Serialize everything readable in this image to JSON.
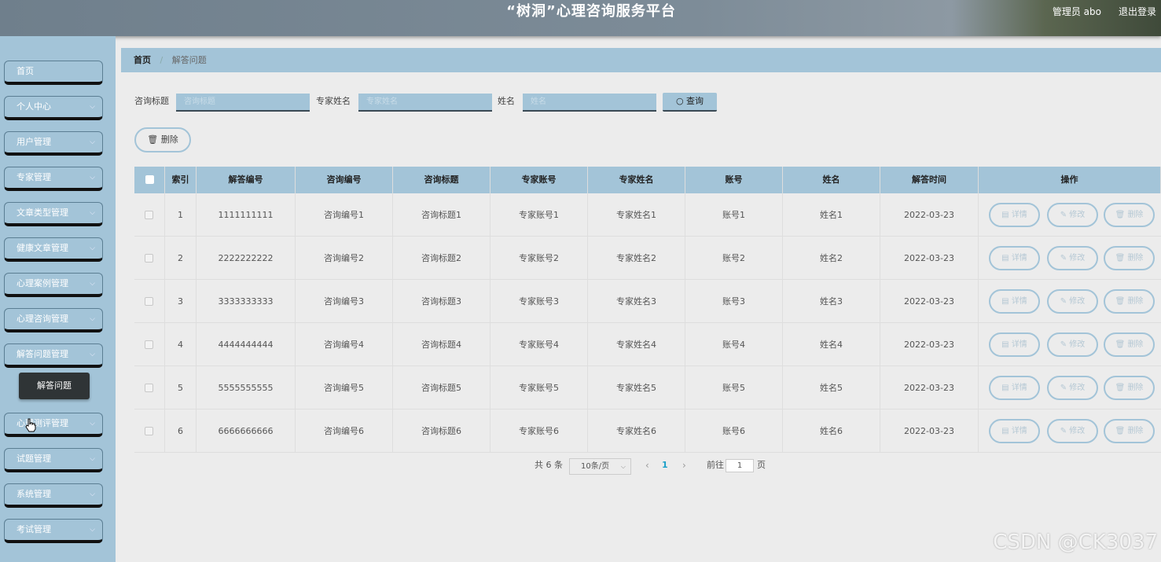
{
  "header": {
    "title": "“树洞”心理咨询服务平台",
    "user": "管理员 abo",
    "logout": "退出登录"
  },
  "sidebar": {
    "items": [
      {
        "label": "首页",
        "has_chevron": false
      },
      {
        "label": "个人中心",
        "has_chevron": true
      },
      {
        "label": "用户管理",
        "has_chevron": true
      },
      {
        "label": "专家管理",
        "has_chevron": true
      },
      {
        "label": "文章类型管理",
        "has_chevron": true
      },
      {
        "label": "健康文章管理",
        "has_chevron": true
      },
      {
        "label": "心理案例管理",
        "has_chevron": true
      },
      {
        "label": "心理咨询管理",
        "has_chevron": true
      },
      {
        "label": "解答问题管理",
        "has_chevron": true
      },
      {
        "label": "心理测评管理",
        "has_chevron": true
      },
      {
        "label": "试题管理",
        "has_chevron": true
      },
      {
        "label": "系统管理",
        "has_chevron": true
      },
      {
        "label": "考试管理",
        "has_chevron": true
      }
    ],
    "submenu": {
      "label": "解答问题"
    }
  },
  "breadcrumb": {
    "home": "首页",
    "current": "解答问题"
  },
  "search": {
    "fields": [
      {
        "label": "咨询标题",
        "placeholder": "咨询标题"
      },
      {
        "label": "专家姓名",
        "placeholder": "专家姓名"
      },
      {
        "label": "姓名",
        "placeholder": "姓名"
      }
    ],
    "query_label": "查询"
  },
  "toolbar": {
    "delete_label": "删除"
  },
  "table": {
    "columns": [
      "",
      "索引",
      "解答编号",
      "咨询编号",
      "咨询标题",
      "专家账号",
      "专家姓名",
      "账号",
      "姓名",
      "解答时间",
      "操作"
    ],
    "rows": [
      [
        "1",
        "1111111111",
        "咨询编号1",
        "咨询标题1",
        "专家账号1",
        "专家姓名1",
        "账号1",
        "姓名1",
        "2022-03-23"
      ],
      [
        "2",
        "2222222222",
        "咨询编号2",
        "咨询标题2",
        "专家账号2",
        "专家姓名2",
        "账号2",
        "姓名2",
        "2022-03-23"
      ],
      [
        "3",
        "3333333333",
        "咨询编号3",
        "咨询标题3",
        "专家账号3",
        "专家姓名3",
        "账号3",
        "姓名3",
        "2022-03-23"
      ],
      [
        "4",
        "4444444444",
        "咨询编号4",
        "咨询标题4",
        "专家账号4",
        "专家姓名4",
        "账号4",
        "姓名4",
        "2022-03-23"
      ],
      [
        "5",
        "5555555555",
        "咨询编号5",
        "咨询标题5",
        "专家账号5",
        "专家姓名5",
        "账号5",
        "姓名5",
        "2022-03-23"
      ],
      [
        "6",
        "6666666666",
        "咨询编号6",
        "咨询标题6",
        "专家账号6",
        "专家姓名6",
        "账号6",
        "姓名6",
        "2022-03-23"
      ]
    ],
    "actions": {
      "detail": "详情",
      "edit": "修改",
      "delete": "删除"
    }
  },
  "pagination": {
    "total_text": "共 6 条",
    "page_size": "10条/页",
    "current_page": "1",
    "goto_prefix": "前往",
    "goto_value": "1",
    "goto_suffix": "页"
  },
  "watermark": "CSDN @CK3037",
  "colors": {
    "accent": "#a3c4d8",
    "header": "#7d8c98",
    "active_page": "#1aa0c8"
  }
}
